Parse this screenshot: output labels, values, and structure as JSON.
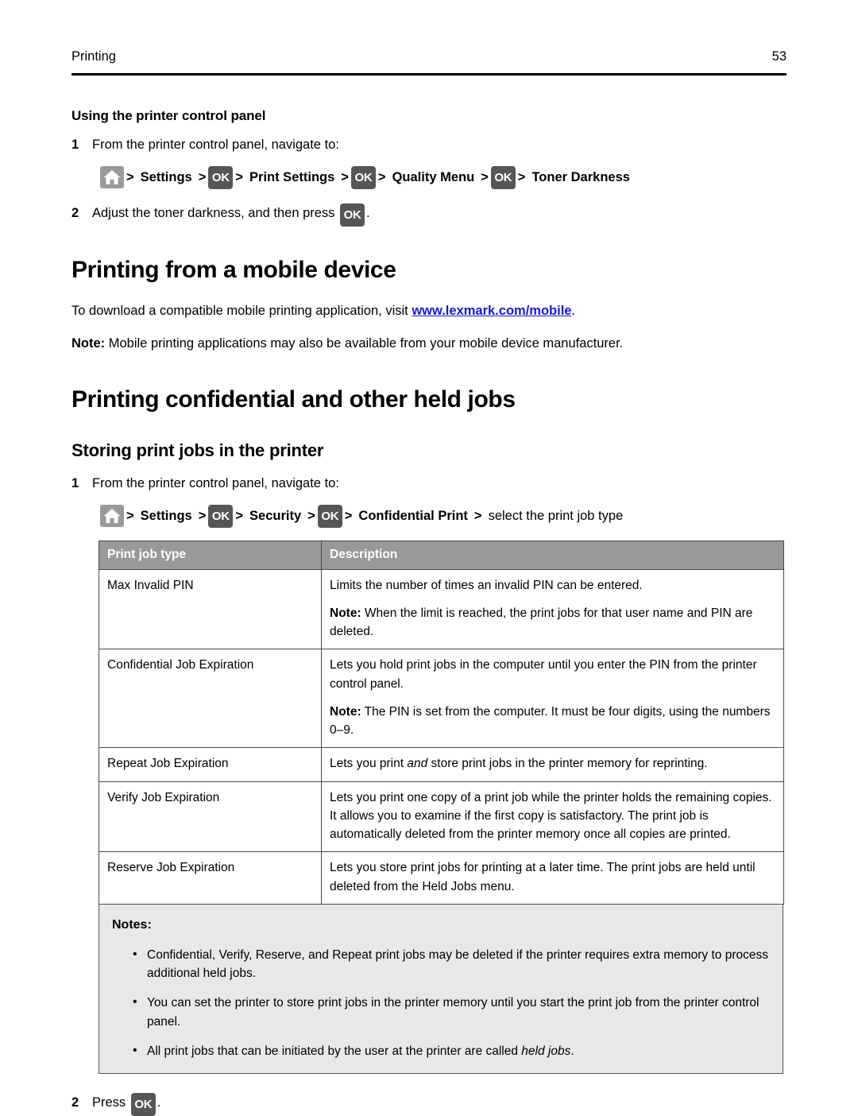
{
  "header": {
    "running_title": "Printing",
    "page_number": "53"
  },
  "icons": {
    "home": "home-icon",
    "ok": "OK"
  },
  "section_control_panel": {
    "heading": "Using the printer control panel",
    "step1": {
      "number": "1",
      "text": "From the printer control panel, navigate to:"
    },
    "navpath": [
      {
        "type": "icon",
        "name": "home-icon"
      },
      {
        "type": "sep",
        "text": ">"
      },
      {
        "type": "crumb",
        "text": "Settings",
        "bold": true
      },
      {
        "type": "sep",
        "text": ">"
      },
      {
        "type": "icon",
        "name": "ok-icon"
      },
      {
        "type": "sep",
        "text": ">"
      },
      {
        "type": "crumb",
        "text": "Print Settings",
        "bold": true
      },
      {
        "type": "sep",
        "text": ">"
      },
      {
        "type": "icon",
        "name": "ok-icon"
      },
      {
        "type": "sep",
        "text": ">"
      },
      {
        "type": "crumb",
        "text": "Quality Menu",
        "bold": true
      },
      {
        "type": "sep",
        "text": ">"
      },
      {
        "type": "icon",
        "name": "ok-icon"
      },
      {
        "type": "sep",
        "text": ">"
      },
      {
        "type": "crumb",
        "text": "Toner Darkness",
        "bold": true
      }
    ],
    "step2": {
      "number": "2",
      "text_before": "Adjust the toner darkness, and then press",
      "text_after": "."
    }
  },
  "section_mobile": {
    "heading": "Printing from a mobile device",
    "paragraph_before_link": "To download a compatible mobile printing application, visit ",
    "link_text": "www.lexmark.com/mobile",
    "paragraph_after_link": ".",
    "note_label": "Note:",
    "note_text": " Mobile printing applications may also be available from your mobile device manufacturer."
  },
  "section_confidential": {
    "heading": "Printing confidential and other held jobs",
    "subheading": "Storing print jobs in the printer",
    "step1": {
      "number": "1",
      "text": "From the printer control panel, navigate to:"
    },
    "navpath": [
      {
        "type": "icon",
        "name": "home-icon"
      },
      {
        "type": "sep",
        "text": ">"
      },
      {
        "type": "crumb",
        "text": "Settings",
        "bold": true
      },
      {
        "type": "sep",
        "text": ">"
      },
      {
        "type": "icon",
        "name": "ok-icon"
      },
      {
        "type": "sep",
        "text": ">"
      },
      {
        "type": "crumb",
        "text": "Security",
        "bold": true
      },
      {
        "type": "sep",
        "text": ">"
      },
      {
        "type": "icon",
        "name": "ok-icon"
      },
      {
        "type": "sep",
        "text": ">"
      },
      {
        "type": "crumb",
        "text": "Confidential Print",
        "bold": true
      },
      {
        "type": "sep",
        "text": ">"
      },
      {
        "type": "crumb",
        "text": "select the print job type",
        "bold": false
      }
    ],
    "step2": {
      "number": "2",
      "text_before": "Press",
      "text_after": "."
    }
  },
  "table": {
    "columns": [
      "Print job type",
      "Description"
    ],
    "rows": [
      {
        "type": "Max Invalid PIN",
        "description_paragraphs": [
          {
            "text": "Limits the number of times an invalid PIN can be entered."
          },
          {
            "note_label": "Note:",
            "text": " When the limit is reached, the print jobs for that user name and PIN are deleted."
          }
        ]
      },
      {
        "type": "Confidential Job Expiration",
        "description_paragraphs": [
          {
            "text": "Lets you hold print jobs in the computer until you enter the PIN from the printer control panel."
          },
          {
            "note_label": "Note:",
            "text": " The PIN is set from the computer. It must be four digits, using the numbers 0–9."
          }
        ]
      },
      {
        "type": "Repeat Job Expiration",
        "description_paragraphs": [
          {
            "text_pre": "Lets you print ",
            "italic": "and",
            "text_post": " store print jobs in the printer memory for reprinting."
          }
        ]
      },
      {
        "type": "Verify Job Expiration",
        "description_paragraphs": [
          {
            "text": "Lets you print one copy of a print job while the printer holds the remaining copies. It allows you to examine if the first copy is satisfactory. The print job is automatically deleted from the printer memory once all copies are printed."
          }
        ]
      },
      {
        "type": "Reserve Job Expiration",
        "description_paragraphs": [
          {
            "text": "Lets you store print jobs for printing at a later time. The print jobs are held until deleted from the Held Jobs menu."
          }
        ]
      }
    ]
  },
  "notes": {
    "title": "Notes:",
    "items": [
      {
        "text": "Confidential, Verify, Reserve, and Repeat print jobs may be deleted if the printer requires extra memory to process additional held jobs."
      },
      {
        "text": "You can set the printer to store print jobs in the printer memory until you start the print job from the printer control panel."
      },
      {
        "text_pre": "All print jobs that can be initiated by the user at the printer are called ",
        "italic": "held jobs",
        "text_post": "."
      }
    ]
  }
}
